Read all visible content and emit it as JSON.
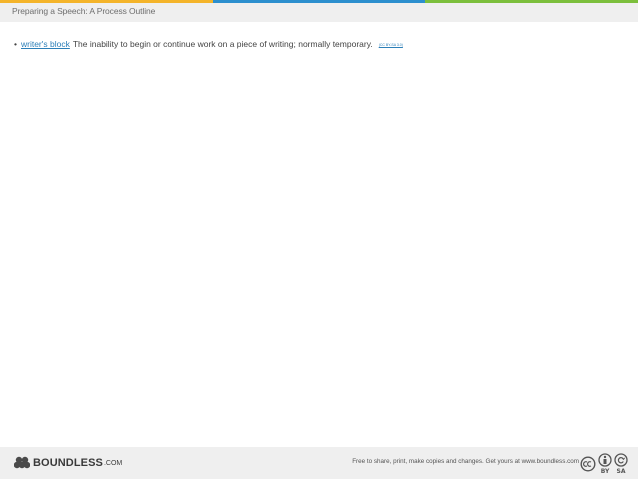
{
  "colors": {
    "accent_segments": [
      "#f4b42a",
      "#2c8fce",
      "#7cbf3c"
    ],
    "link": "#2c7fb8",
    "header_bg": "#efefef"
  },
  "header": {
    "title": "Preparing a Speech: A Process Outline"
  },
  "definition": {
    "bullet": "•",
    "term": "writer's block",
    "text": "The inability to begin or continue work on a piece of writing; normally temporary.",
    "license": "(CC BY-SA 3.0)"
  },
  "footer": {
    "brand": "BOUNDLESS",
    "brand_tld": ".COM",
    "tagline": "Free to share, print, make copies and changes. Get yours at www.boundless.com",
    "icons": [
      "cc-icon",
      "by-icon",
      "sa-icon"
    ]
  }
}
